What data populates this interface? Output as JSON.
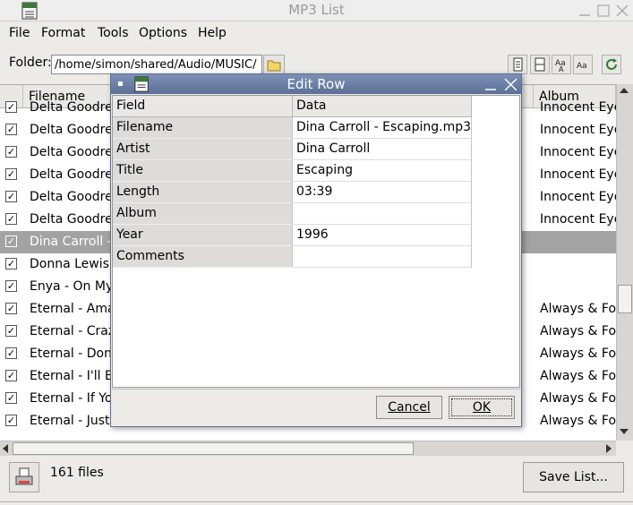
{
  "window": {
    "title": "MP3 List"
  },
  "menu": [
    {
      "label": "File"
    },
    {
      "label": "Format"
    },
    {
      "label": "Tools"
    },
    {
      "label": "Options"
    },
    {
      "label": "Help"
    }
  ],
  "folder": {
    "label": "Folder:",
    "path": "/home/simon/shared/Audio/MUSIC/"
  },
  "table": {
    "headers": {
      "filename": "Filename",
      "album": "Album"
    },
    "rows": [
      {
        "filename": "Delta Goodre",
        "album": "Innocent Eye",
        "checked": "✓"
      },
      {
        "filename": "Delta Goodre",
        "album": "Innocent Eye",
        "checked": "✓"
      },
      {
        "filename": "Delta Goodre",
        "album": "Innocent Eye",
        "checked": "✓"
      },
      {
        "filename": "Delta Goodre",
        "album": "Innocent Eye",
        "checked": "✓"
      },
      {
        "filename": "Delta Goodre",
        "album": "Innocent Eye",
        "checked": "✓"
      },
      {
        "filename": "Delta Goodre",
        "album": "Innocent Eye",
        "checked": "✓"
      },
      {
        "filename": "Dina Carroll -",
        "album": "",
        "checked": "✓"
      },
      {
        "filename": "Donna Lewis",
        "album": "",
        "checked": "✓"
      },
      {
        "filename": "Enya - On My",
        "album": "",
        "checked": "✓"
      },
      {
        "filename": "Eternal - Ama",
        "album": "Always & For",
        "checked": "✓"
      },
      {
        "filename": "Eternal - Craz",
        "album": "Always & For",
        "checked": "✓"
      },
      {
        "filename": "Eternal - Don",
        "album": "Always & For",
        "checked": "✓"
      },
      {
        "filename": "Eternal - I'll B",
        "album": "Always & For",
        "checked": "✓"
      },
      {
        "filename": "Eternal - If Yo",
        "album": "Always & For",
        "checked": "✓"
      },
      {
        "filename": "Eternal - Just",
        "album": "Always & For",
        "checked": "✓"
      }
    ],
    "selected_index": 6
  },
  "status": {
    "files_count": "161 files",
    "save_label": "Save List..."
  },
  "dialog": {
    "title": "Edit Row",
    "headers": {
      "field": "Field",
      "data": "Data"
    },
    "rows": [
      {
        "field": "Filename",
        "data": "Dina Carroll - Escaping.mp3"
      },
      {
        "field": "Artist",
        "data": "Dina Carroll"
      },
      {
        "field": "Title",
        "data": "Escaping"
      },
      {
        "field": "Length",
        "data": "03:39"
      },
      {
        "field": "Album",
        "data": ""
      },
      {
        "field": "Year",
        "data": "1996"
      },
      {
        "field": "Comments",
        "data": ""
      }
    ],
    "cancel_label": "Cancel",
    "ok_label": "OK"
  },
  "icons": {
    "app": "mp3-list-icon",
    "folder_browse": "folder-open-icon",
    "toolbar": [
      "select-all-icon",
      "columns-icon",
      "text-case-icon",
      "font-icon",
      "refresh-icon"
    ],
    "status": "printer-icon"
  },
  "colors": {
    "dialog_title": "#5c7098",
    "selection": "#a3a3a3"
  }
}
